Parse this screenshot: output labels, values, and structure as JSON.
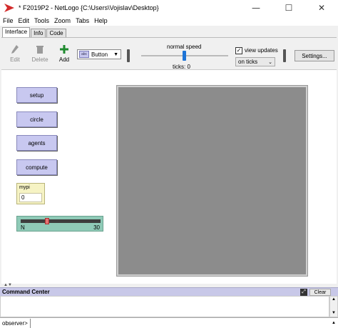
{
  "window": {
    "title": "* F2019P2 - NetLogo {C:\\Users\\Vojislav\\Desktop}",
    "minimize": "—",
    "maximize": "☐",
    "close": "✕"
  },
  "menu": [
    "File",
    "Edit",
    "Tools",
    "Zoom",
    "Tabs",
    "Help"
  ],
  "tabs": [
    {
      "label": "Interface",
      "active": true
    },
    {
      "label": "Info",
      "active": false
    },
    {
      "label": "Code",
      "active": false
    }
  ],
  "toolbar": {
    "edit_label": "Edit",
    "delete_label": "Delete",
    "add_label": "Add",
    "widget_type": "Button",
    "widget_icon_text": "abc",
    "speed_label": "normal speed",
    "speed_value": 0.5,
    "ticks_text": "ticks: 0",
    "view_updates_label": "view updates",
    "view_updates_checked": true,
    "update_mode": "on ticks",
    "settings_label": "Settings..."
  },
  "widgets": {
    "buttons": [
      "setup",
      "circle",
      "agents",
      "compute"
    ],
    "monitor": {
      "label": "mypi",
      "value": "0"
    },
    "slider": {
      "name": "N",
      "value": "30",
      "fraction": 0.33
    }
  },
  "command_center": {
    "title": "Command Center",
    "clear_label": "Clear",
    "resize_icon_text": "⤢",
    "agent_selector": "observer>",
    "input_value": ""
  },
  "colors": {
    "button": "#c8c8f0",
    "monitor": "#f6f3c4",
    "slider": "#8fcab7",
    "world": "#8c8c8c",
    "speed_thumb": "#1e74d6",
    "add_icon": "#1e8a2e",
    "logo": "#d32b2b"
  }
}
